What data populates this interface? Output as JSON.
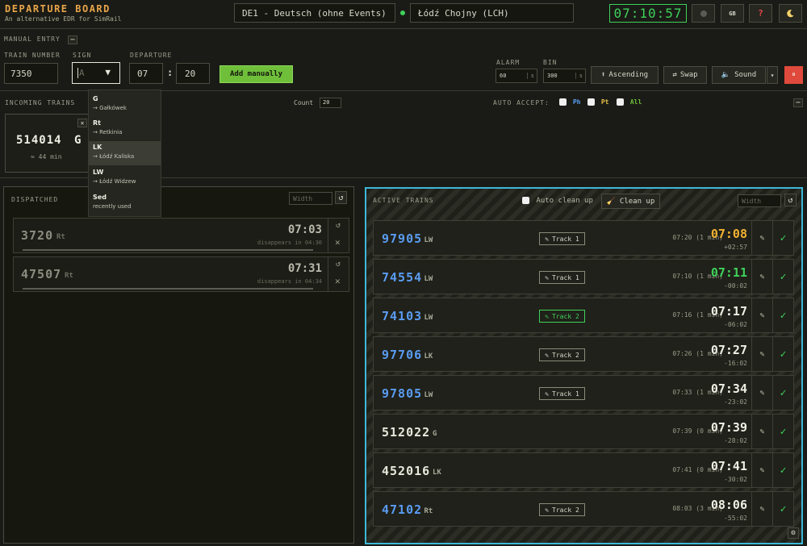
{
  "header": {
    "title": "DEPARTURE BOARD",
    "subtitle": "An alternative EDR for SimRail",
    "server": "DE1 - Deutsch (ohne Events)",
    "station": "Łódź Chojny (LCH)",
    "clock": "07:10:57",
    "lang_button": "GB",
    "help_button": "?",
    "theme_icon": "moon-icon",
    "status_color": "#3fd15a"
  },
  "manual_entry": {
    "section_label": "MANUAL ENTRY",
    "collapse": "−",
    "train_number_label": "TRAIN NUMBER",
    "train_number_value": "7350",
    "sign_label": "SIGN",
    "sign_placeholder": "A",
    "departure_label": "DEPARTURE",
    "dep_hour": "07",
    "dep_sep": ":",
    "dep_min": "20",
    "add_button": "Add manually",
    "alarm_label": "ALARM",
    "alarm_value": "60",
    "alarm_unit": "s",
    "bin_label": "BIN",
    "bin_value": "300",
    "bin_unit": "s",
    "ascending_button": "Ascending",
    "swap_button": "Swap",
    "sound_button": "Sound",
    "sound_arrow": "▾",
    "pause_button": "⏸"
  },
  "sign_dropdown": [
    {
      "code": "G",
      "dest": "→ Gałkówek"
    },
    {
      "code": "Rt",
      "dest": "→ Retkinia"
    },
    {
      "code": "LK",
      "dest": "→ Łódź Kaliska"
    },
    {
      "code": "LW",
      "dest": "→ Łódź Widzew"
    },
    {
      "code": "Sed",
      "dest": "recently used"
    }
  ],
  "incoming": {
    "label": "INCOMING TRAINS",
    "count_label": "Count",
    "count_value": "20",
    "auto_accept_label": "AUTO ACCEPT:",
    "opt_ph": "Ph",
    "opt_pt": "Pt",
    "opt_all": "All",
    "collapse": "−",
    "card": {
      "number": "514014",
      "sign": "G",
      "eta": "≈ 44 min",
      "close": "✕"
    }
  },
  "dispatched": {
    "label": "DISPATCHED",
    "width_placeholder": "Width",
    "reset": "↺",
    "rows": [
      {
        "number": "3720",
        "sign": "Rt",
        "time": "07:03",
        "note": "disappears in 04:30",
        "undo": "↺",
        "remove": "✕"
      },
      {
        "number": "47507",
        "sign": "Rt",
        "time": "07:31",
        "note": "disappears in 04:34",
        "undo": "↺",
        "remove": "✕"
      }
    ]
  },
  "active": {
    "label": "ACTIVE TRAINS",
    "auto_clean_label": "Auto clean up",
    "clean_button": "Clean up",
    "width_placeholder": "Width",
    "reset": "↺",
    "settings": "⚙",
    "rows": [
      {
        "number": "97905",
        "sign": "LW",
        "track": "Track 1",
        "sched": "07:20 (1 min)",
        "time": "07:08",
        "delay": "+02:57",
        "num_color": "#5a9cf2",
        "time_color": "#f2b233",
        "track_hl": false
      },
      {
        "number": "74554",
        "sign": "LW",
        "track": "Track 1",
        "sched": "07:10 (1 min)",
        "time": "07:11",
        "delay": "-00:02",
        "num_color": "#5a9cf2",
        "time_color": "#3fd15a",
        "track_hl": false
      },
      {
        "number": "74103",
        "sign": "LW",
        "track": "Track 2",
        "sched": "07:16 (1 min)",
        "time": "07:17",
        "delay": "-06:02",
        "num_color": "#5a9cf2",
        "time_color": "#eeeee4",
        "track_hl": true
      },
      {
        "number": "97706",
        "sign": "LK",
        "track": "Track 2",
        "sched": "07:26 (1 min)",
        "time": "07:27",
        "delay": "-16:02",
        "num_color": "#5a9cf2",
        "time_color": "#eeeee4",
        "track_hl": false
      },
      {
        "number": "97805",
        "sign": "LW",
        "track": "Track 1",
        "sched": "07:33 (1 min)",
        "time": "07:34",
        "delay": "-23:02",
        "num_color": "#5a9cf2",
        "time_color": "#eeeee4",
        "track_hl": false
      },
      {
        "number": "512022",
        "sign": "G",
        "track": "",
        "sched": "07:39 (0 min)",
        "time": "07:39",
        "delay": "-28:02",
        "num_color": "#e8e8dc",
        "time_color": "#eeeee4",
        "track_hl": false
      },
      {
        "number": "452016",
        "sign": "LK",
        "track": "",
        "sched": "07:41 (0 min)",
        "time": "07:41",
        "delay": "-30:02",
        "num_color": "#e8e8dc",
        "time_color": "#eeeee4",
        "track_hl": false
      },
      {
        "number": "47102",
        "sign": "Rt",
        "track": "Track 2",
        "sched": "08:03 (3 min)",
        "time": "08:06",
        "delay": "-55:02",
        "num_color": "#5a9cf2",
        "time_color": "#eeeee4",
        "track_hl": false
      }
    ]
  }
}
